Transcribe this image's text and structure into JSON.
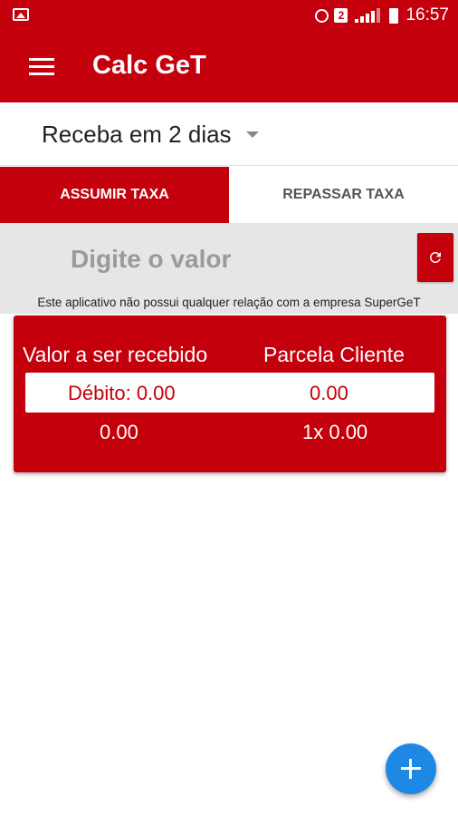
{
  "statusbar": {
    "time": "16:57",
    "sim_badge": "2"
  },
  "appbar": {
    "title": "Calc GeT",
    "menu_icon": "hamburger-menu-icon"
  },
  "dropdown": {
    "selected": "Receba em 2 dias"
  },
  "tabs": [
    {
      "label": "ASSUMIR TAXA",
      "active": true
    },
    {
      "label": "REPASSAR TAXA",
      "active": false
    }
  ],
  "input": {
    "placeholder": "Digite o valor",
    "value": ""
  },
  "refresh_icon": "refresh-icon",
  "disclaimer": "Este aplicativo não possui qualquer relação com a empresa SuperGeT",
  "card": {
    "headers": [
      "Valor a ser recebido",
      "Parcela Cliente"
    ],
    "rows": [
      {
        "left": "Débito: 0.00",
        "right": "0.00"
      },
      {
        "left": "0.00",
        "right": "1x 0.00"
      }
    ]
  },
  "fab_icon": "plus-icon",
  "colors": {
    "primary": "#c4000c",
    "fab": "#1e88e5",
    "input_bg": "#e6e6e6"
  }
}
